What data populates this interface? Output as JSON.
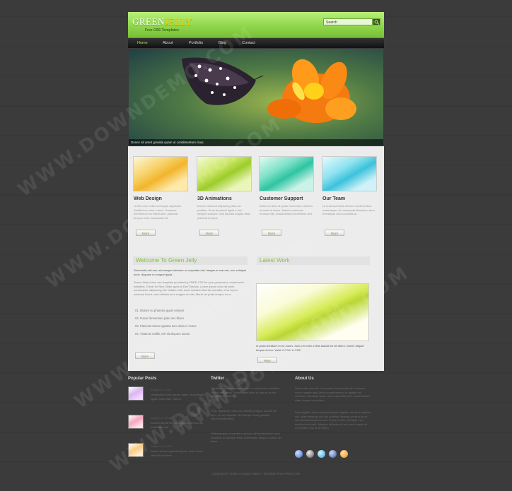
{
  "header": {
    "logo_part1": "GREEN",
    "logo_part2": "JELLY",
    "tagline": "Free CSS Templates",
    "search_placeholder": "Search"
  },
  "nav": [
    "Home",
    "About",
    "Portfolio",
    "Blog",
    "Contact"
  ],
  "hero": {
    "caption": "Donec sit amet gravida quam ut condimentum risus."
  },
  "features": [
    {
      "title": "Web Design",
      "text": "Ut elit nunc nulla consequat dignissim. Vestibulum vitae a dolor. Praesent elementum hendrerit ante, placerat tempus ante malesuada sit.",
      "more": "More"
    },
    {
      "title": "3D Animations",
      "text": "Donec euismod adipiscing diam ac porttitor. Proin hendrerit ligula a nisl semper suscipit. Duis lobortis magna vitae placerat tempus.",
      "more": "More"
    },
    {
      "title": "Customer Support",
      "text": "Etiam eu ante ut quam fermentum ultricies at amet at lectus. Mauris commodo rhoncus elit, condimentum at eleifend sed.",
      "more": "More"
    },
    {
      "title": "Our Team",
      "text": "Ut euismod tellus elit sed condimentum scelerisque. Ut consequat bibendum arcu, in tristique arcu convallis at.",
      "more": "More"
    }
  ],
  "welcome": {
    "title": "Welcome To Green Jelly",
    "lead": "Sed mollis nisi non nisl semper interdum ut vulputate nisl. Integer in erat nec, nec volutpat nunc. Aliquam in congue ligula.",
    "body": "Green Jelly is free css template provided by FREE CSS for your personal or commercial websites. Credit for Nice Slider goes to DevThreads. Lorem ipsum dolor sit amet, consectetur adipiscing elit. Nullam velit, amet sodales lobortis convallis, eros sapien euismod lectus, sed ultricies arcu magna vel nisl. Morbi vel porta tempor nunc.",
    "list": [
      "01. Dictum eu pharetra quam semper",
      "02. Fusce fermentum justo nec libero",
      "03. Placerat metus egestas sem diam in lectus",
      "04. Vivamus mollis, nisl sit aliquam auctor"
    ],
    "more": "More"
  },
  "latest": {
    "title": "Latest Work",
    "caption": "In porta tincidunt ex eu mattis. Nam vel dolor a felis blandit sit vel libero. Donec aliquet tempor lectus. Valid XHTML & CSS.",
    "more": "More"
  },
  "popular": {
    "title": "Popular Posts",
    "posts": [
      {
        "date": "August 22, 2048",
        "text": "Vestibulum lorem ipsum amet, ut venenatis ligula molis vitae mauris."
      },
      {
        "date": "August 20, 2048",
        "text": "Aenean turpis feugiat sed, nec ultrices dui mollis sed nisi."
      },
      {
        "date": "August 18, 2048",
        "text": "Donec sit amet gravida quam, dolor lorem vehicula sit amet."
      }
    ]
  },
  "twitter": {
    "title": "Twitter",
    "tweets": [
      "Curabitur sed dui venenatis arcu condimentum facilisis. Ut sed nisl lorem. Donec eget tortor at mauris at nisi. http://bit.ly/13hoPD",
      "Proin dignissim, diam nec blandit congue, mauris est arcu, mi vel molestie elit. Integer fusce gravida. http://bit.ly/kbxMvz",
      "Pellentesque consectetur ultricies @Templatebdo tortor pharetra, ac semper tellus fermentum tempor, rutrum vel tellus."
    ]
  },
  "about": {
    "title": "About Us",
    "p1": "Sed mollis non nisi. Ut semper nisi gravida dui. Vivamus cursus sapien quis lectus condimentum in sagittis leo vehicula. Curabitur quam urna, imperdiet quis condimentum vitae, tempor non diam.",
    "p2": "Duis sagittis, dolor sit amet tempor fringilla, nisi sem dapibus nisl, vitae euismod nisl nisl ut tellus. Aenean porta nunc at nisl sed accumsan mauris. Fusce mollis, velit quis, non tincidunt nisl velit. Aliquam sit luctus ut arcu sed mauris at non lectus, orci ut sit lorem."
  },
  "social_icons": [
    "flickr-icon",
    "delicious-icon",
    "twitter-icon",
    "facebook-icon",
    "rss-icon"
  ],
  "copyright": "Copyright © 2048 Company Name | Template from FREE CSS",
  "watermark": "WWW.DOWNDEMO.COM",
  "colors": {
    "accent": "#7ec03c",
    "header": "#8fd64c",
    "background": "#3a3a3a"
  }
}
